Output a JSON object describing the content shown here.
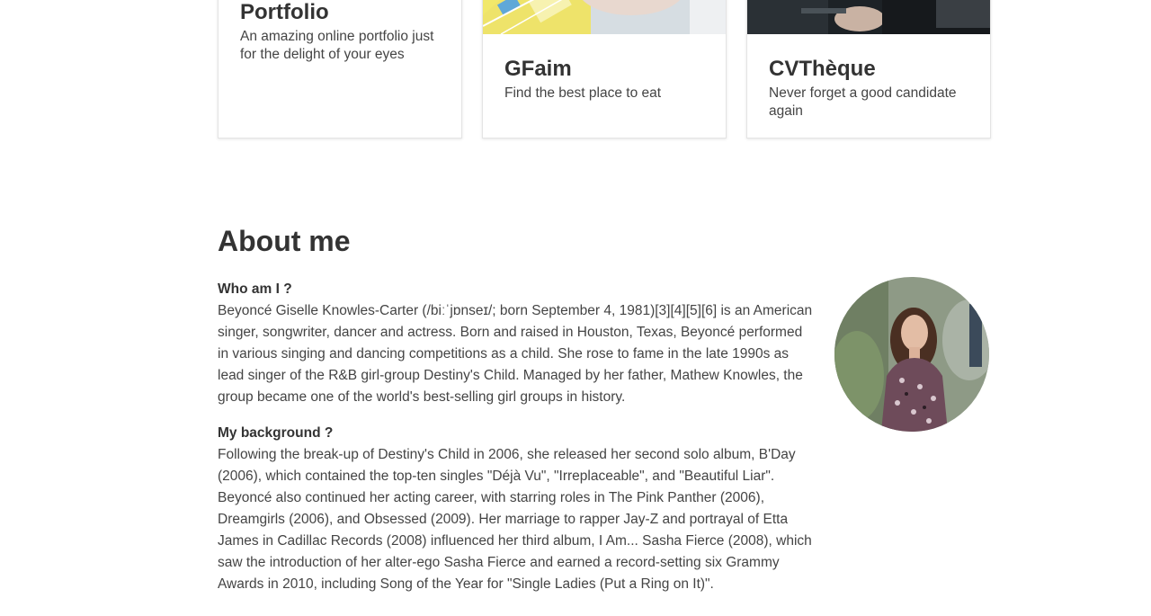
{
  "projects": [
    {
      "title": "Portfolio",
      "description": "An amazing online portfolio just for the delight of your eyes"
    },
    {
      "title": "GFaim",
      "description": "Find the best place to eat"
    },
    {
      "title": "CVThèque",
      "description": "Never forget a good candidate again"
    }
  ],
  "about": {
    "title": "About me",
    "sections": [
      {
        "heading": "Who am I ?",
        "text": "Beyoncé Giselle Knowles-Carter (/biːˈjɒnseɪ/; born September 4, 1981)[3][4][5][6] is an American singer, songwriter, dancer and actress. Born and raised in Houston, Texas, Beyoncé performed in various singing and dancing competitions as a child. She rose to fame in the late 1990s as lead singer of the R&B girl-group Destiny's Child. Managed by her father, Mathew Knowles, the group became one of the world's best-selling girl groups in history."
      },
      {
        "heading": "My background ?",
        "text": "Following the break-up of Destiny's Child in 2006, she released her second solo album, B'Day (2006), which contained the top-ten singles \"Déjà Vu\", \"Irreplaceable\", and \"Beautiful Liar\". Beyoncé also continued her acting career, with starring roles in The Pink Panther (2006), Dreamgirls (2006), and Obsessed (2009). Her marriage to rapper Jay-Z and portrayal of Etta James in Cadillac Records (2008) influenced her third album, I Am... Sasha Fierce (2008), which saw the introduction of her alter-ego Sasha Fierce and earned a record-setting six Grammy Awards in 2010, including Song of the Year for \"Single Ladies (Put a Ring on It)\"."
      }
    ]
  }
}
